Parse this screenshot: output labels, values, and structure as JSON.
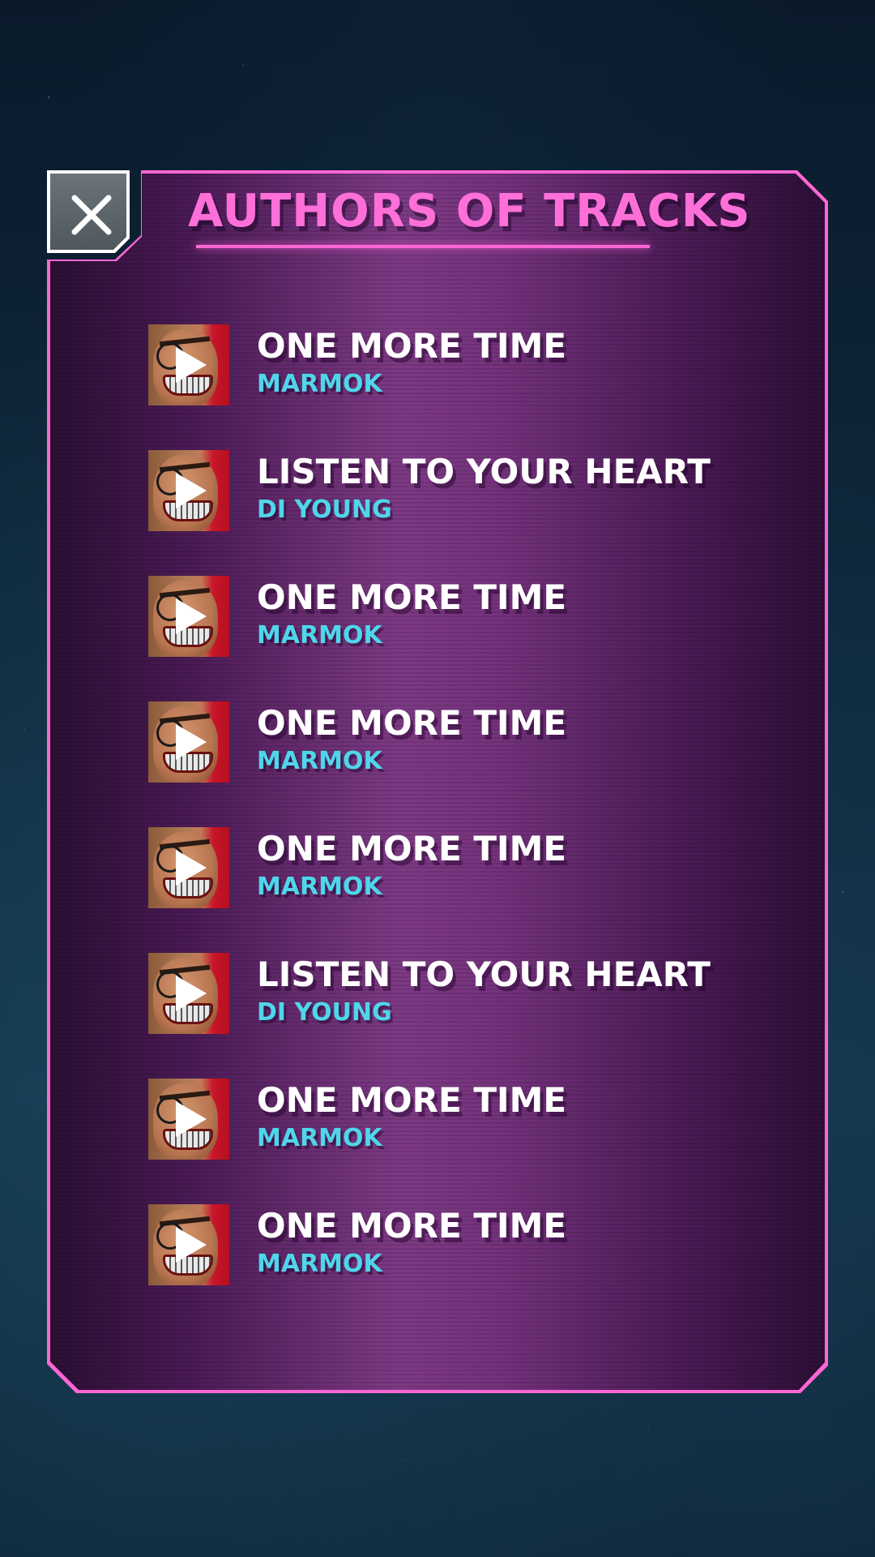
{
  "panel": {
    "title": "AUTHORS OF TRACKS",
    "close_icon": "close-icon"
  },
  "tracks": [
    {
      "title": "ONE MORE TIME",
      "author": "MARMOK"
    },
    {
      "title": "LISTEN TO YOUR HEART",
      "author": "DI YOUNG"
    },
    {
      "title": "ONE MORE TIME",
      "author": "MARMOK"
    },
    {
      "title": "ONE MORE TIME",
      "author": "MARMOK"
    },
    {
      "title": "ONE MORE TIME",
      "author": "MARMOK"
    },
    {
      "title": "LISTEN TO YOUR HEART",
      "author": "DI YOUNG"
    },
    {
      "title": "ONE MORE TIME",
      "author": "MARMOK"
    },
    {
      "title": "ONE MORE TIME",
      "author": "MARMOK"
    }
  ],
  "colors": {
    "accent_pink": "#ff66d4",
    "author_cyan": "#4fd6ea",
    "title_white": "#ffffff"
  },
  "icons": {
    "thumbnail": "avatar-thumbnail",
    "play": "play-icon"
  }
}
